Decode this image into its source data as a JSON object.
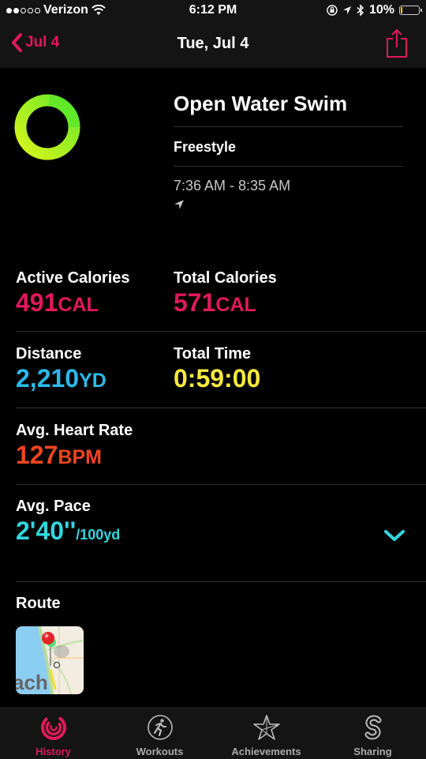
{
  "status_bar": {
    "signal_bars_filled": 2,
    "signal_bars_total": 5,
    "carrier": "Verizon",
    "time": "6:12 PM",
    "battery_percent_label": "10%",
    "battery_level": 0.1,
    "icons": [
      "wifi-icon",
      "orientation-lock-icon",
      "location-icon",
      "bluetooth-icon",
      "battery-icon"
    ]
  },
  "nav": {
    "back_label": "Jul 4",
    "title": "Tue, Jul 4",
    "share_icon": "share-icon"
  },
  "workout": {
    "title": "Open Water Swim",
    "stroke": "Freestyle",
    "time_range": "7:36 AM - 8:35 AM",
    "ring_progress": 1.0,
    "colors": {
      "ring_start": "#d7f51c",
      "ring_end": "#4ee62a"
    }
  },
  "metrics": {
    "active_calories": {
      "label": "Active Calories",
      "value": "491",
      "unit": "CAL",
      "color": "#e0195a"
    },
    "total_calories": {
      "label": "Total Calories",
      "value": "571",
      "unit": "CAL",
      "color": "#e0195a"
    },
    "distance": {
      "label": "Distance",
      "value": "2,210",
      "unit": "YD",
      "color": "#2cb9ea"
    },
    "total_time": {
      "label": "Total Time",
      "value": "0:59:00",
      "unit": "",
      "color": "#f5ea3c"
    },
    "avg_heart_rate": {
      "label": "Avg. Heart Rate",
      "value": "127",
      "unit": "BPM",
      "color": "#f0451f"
    },
    "avg_pace": {
      "label": "Avg. Pace",
      "value": "2'40''",
      "unit": "/100yd",
      "color": "#33d6de"
    }
  },
  "route": {
    "label": "Route",
    "map_text": "ach"
  },
  "tabs": [
    {
      "label": "History",
      "icon": "history-icon",
      "active": true
    },
    {
      "label": "Workouts",
      "icon": "workouts-icon",
      "active": false
    },
    {
      "label": "Achievements",
      "icon": "achievements-icon",
      "active": false
    },
    {
      "label": "Sharing",
      "icon": "sharing-icon",
      "active": false
    }
  ],
  "accent": "#e0195a"
}
